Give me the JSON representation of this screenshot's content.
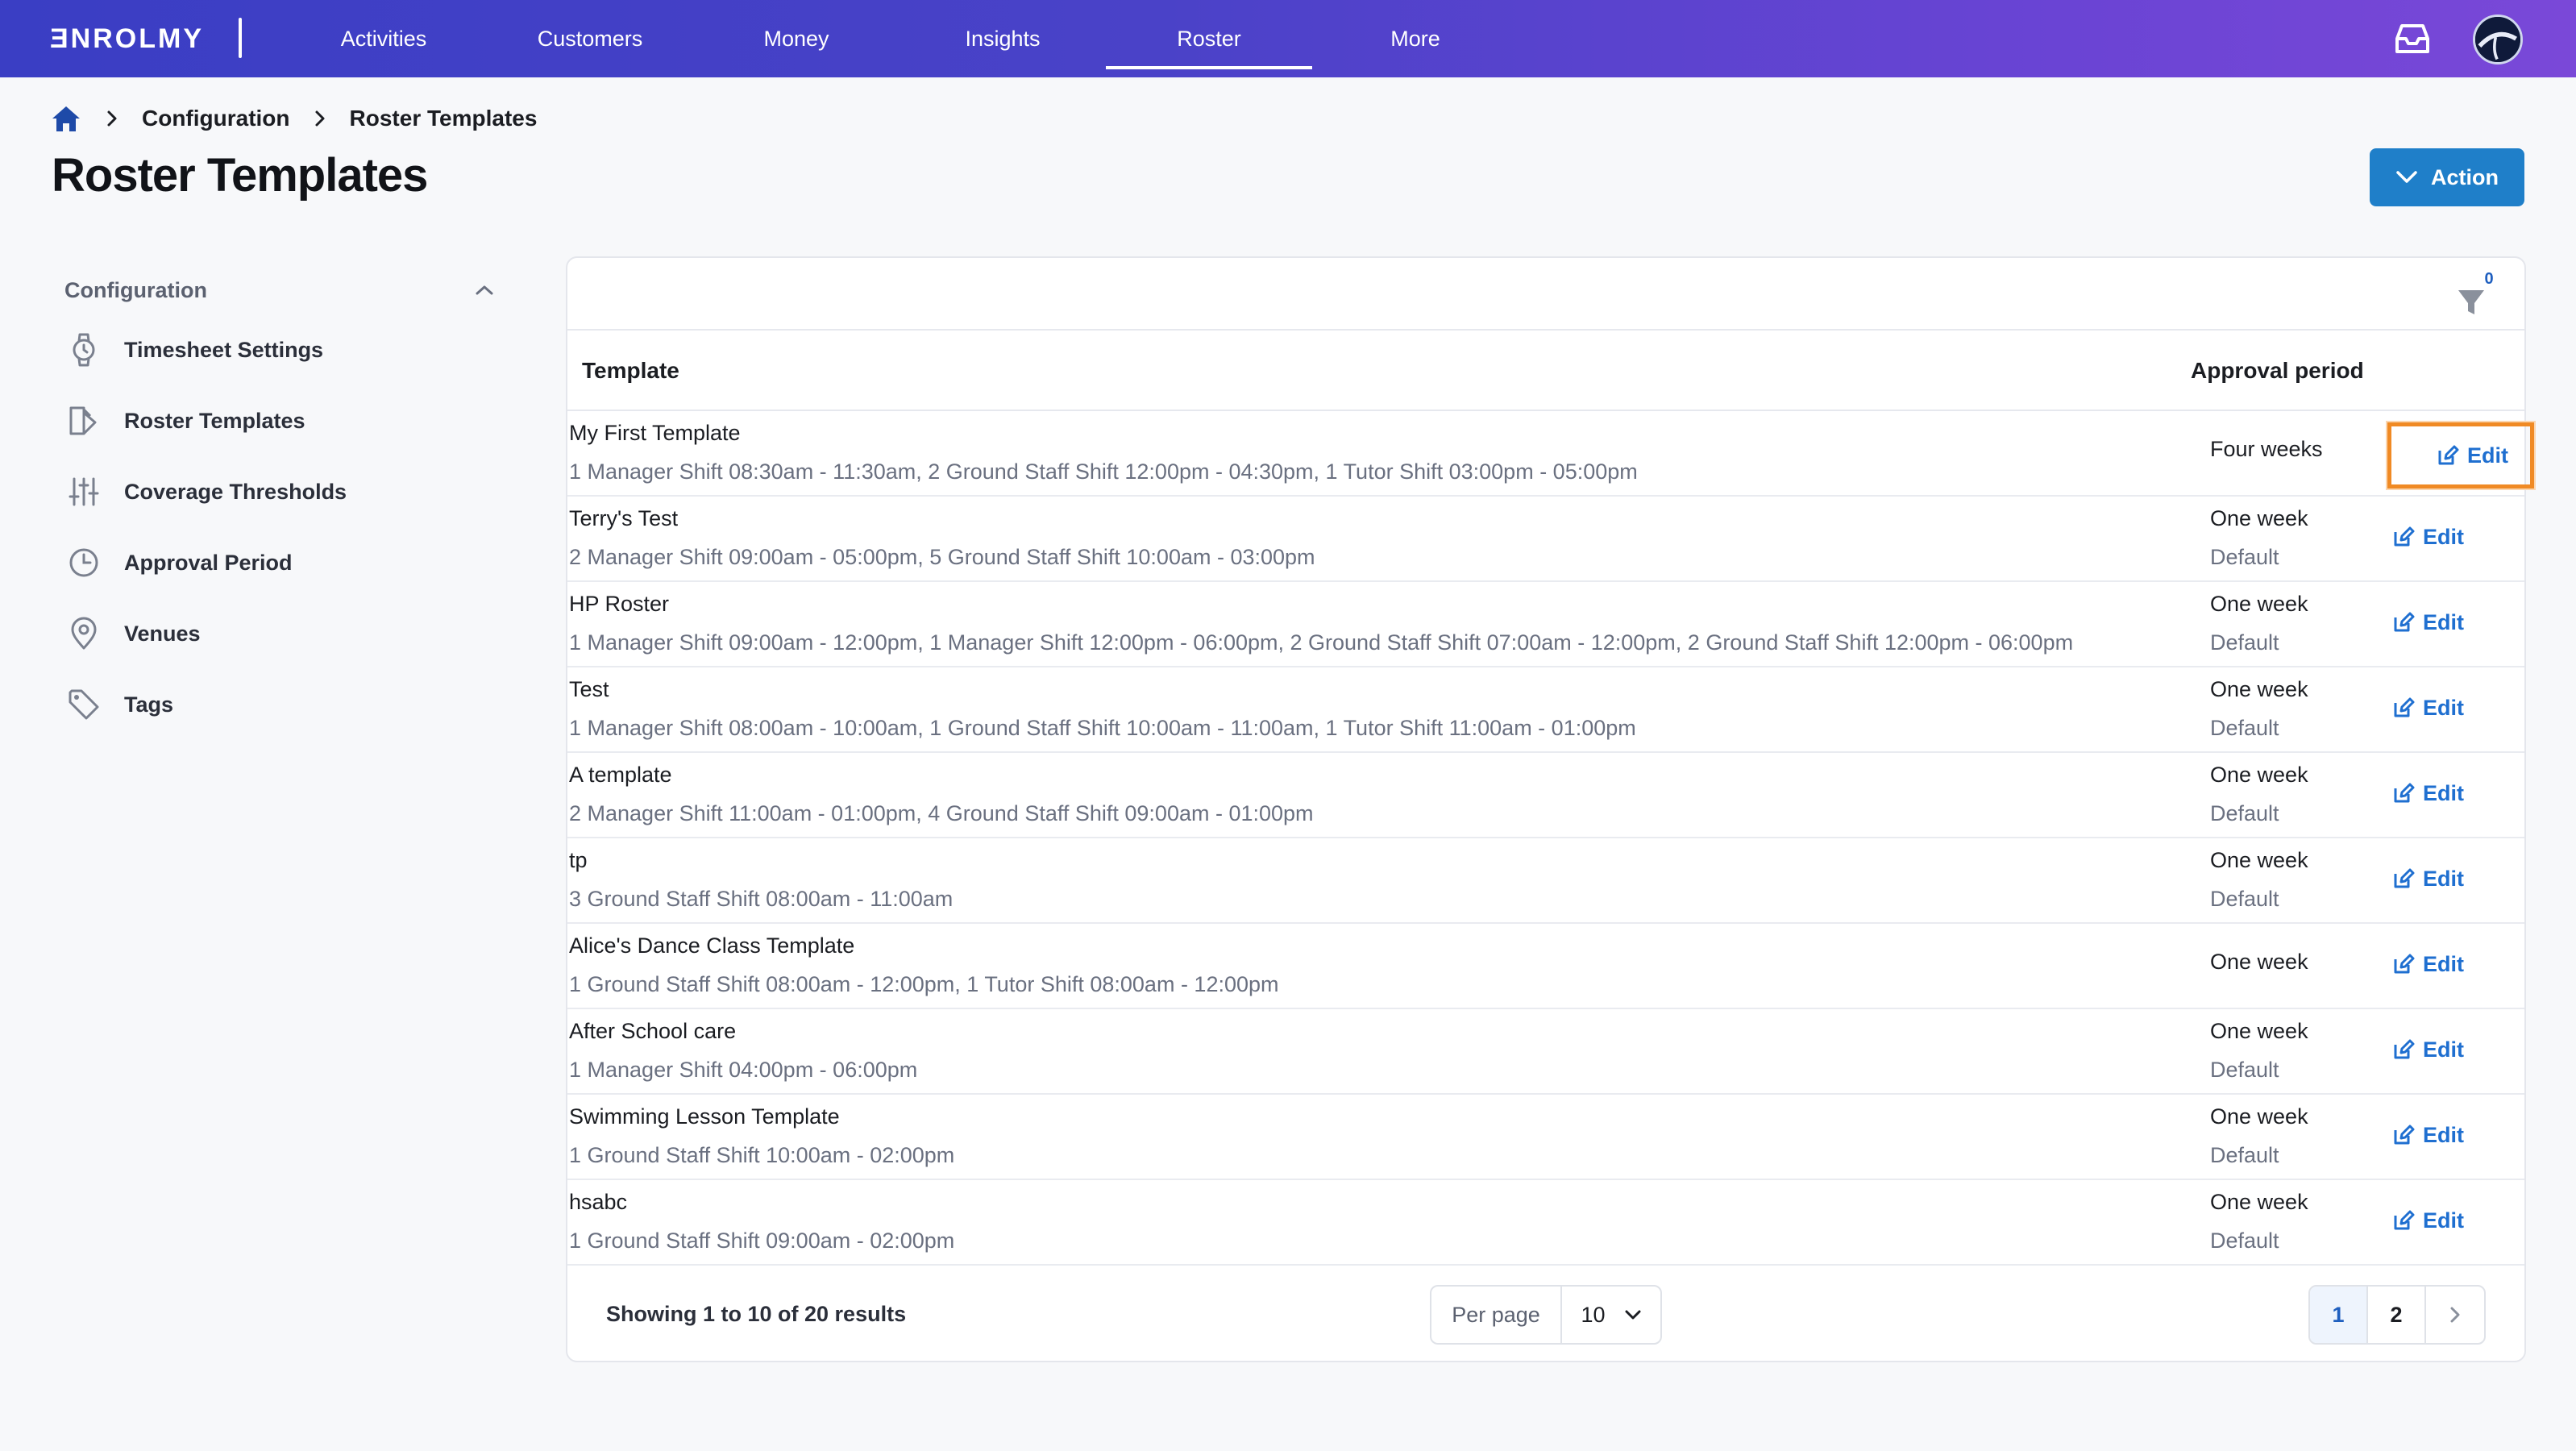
{
  "brand": {
    "logo_text": "ƎNROLMY"
  },
  "nav": {
    "items": [
      {
        "label": "Activities"
      },
      {
        "label": "Customers"
      },
      {
        "label": "Money"
      },
      {
        "label": "Insights"
      },
      {
        "label": "Roster"
      },
      {
        "label": "More"
      }
    ],
    "active": "Roster"
  },
  "breadcrumb": {
    "items": [
      "Configuration",
      "Roster Templates"
    ]
  },
  "page": {
    "title": "Roster Templates",
    "action_label": "Action"
  },
  "sidebar": {
    "header": "Configuration",
    "items": [
      {
        "label": "Timesheet Settings",
        "icon": "watch-icon"
      },
      {
        "label": "Roster Templates",
        "icon": "template-icon"
      },
      {
        "label": "Coverage Thresholds",
        "icon": "sliders-icon"
      },
      {
        "label": "Approval Period",
        "icon": "clock-icon"
      },
      {
        "label": "Venues",
        "icon": "location-pin-icon"
      },
      {
        "label": "Tags",
        "icon": "tag-icon"
      }
    ]
  },
  "filter": {
    "count": "0"
  },
  "table": {
    "columns": {
      "template": "Template",
      "approval": "Approval period"
    },
    "edit_label": "Edit",
    "rows": [
      {
        "name": "My First Template",
        "shifts": "1 Manager Shift 08:30am - 11:30am, 2 Ground Staff Shift 12:00pm - 04:30pm, 1 Tutor Shift 03:00pm - 05:00pm",
        "period": "Four weeks",
        "default": ""
      },
      {
        "name": "Terry's Test",
        "shifts": "2 Manager Shift 09:00am - 05:00pm, 5 Ground Staff Shift 10:00am - 03:00pm",
        "period": "One week",
        "default": "Default"
      },
      {
        "name": "HP Roster",
        "shifts": "1 Manager Shift 09:00am - 12:00pm, 1 Manager Shift 12:00pm - 06:00pm, 2 Ground Staff Shift 07:00am - 12:00pm, 2 Ground Staff Shift 12:00pm - 06:00pm",
        "period": "One week",
        "default": "Default"
      },
      {
        "name": "Test",
        "shifts": "1 Manager Shift 08:00am - 10:00am, 1 Ground Staff Shift 10:00am - 11:00am, 1 Tutor Shift 11:00am - 01:00pm",
        "period": "One week",
        "default": "Default"
      },
      {
        "name": "A template",
        "shifts": "2 Manager Shift 11:00am - 01:00pm, 4 Ground Staff Shift 09:00am - 01:00pm",
        "period": "One week",
        "default": "Default"
      },
      {
        "name": "tp",
        "shifts": "3 Ground Staff Shift 08:00am - 11:00am",
        "period": "One week",
        "default": "Default"
      },
      {
        "name": "Alice's Dance Class Template",
        "shifts": "1 Ground Staff Shift 08:00am - 12:00pm, 1 Tutor Shift 08:00am - 12:00pm",
        "period": "One week",
        "default": ""
      },
      {
        "name": "After School care",
        "shifts": "1 Manager Shift 04:00pm - 06:00pm",
        "period": "One week",
        "default": "Default"
      },
      {
        "name": "Swimming Lesson Template",
        "shifts": "1 Ground Staff Shift 10:00am - 02:00pm",
        "period": "One week",
        "default": "Default"
      },
      {
        "name": "hsabc",
        "shifts": "1 Ground Staff Shift 09:00am - 02:00pm",
        "period": "One week",
        "default": "Default"
      }
    ]
  },
  "footer": {
    "results_text": "Showing 1 to 10 of 20 results",
    "per_page_label": "Per page",
    "per_page_value": "10",
    "pages": [
      "1",
      "2"
    ],
    "current_page": "1"
  },
  "colors": {
    "nav_start": "#3a3ec4",
    "nav_end": "#7a48d8",
    "accent": "#1f7fc9",
    "link": "#1f6fd0",
    "highlight": "#f08a24"
  }
}
